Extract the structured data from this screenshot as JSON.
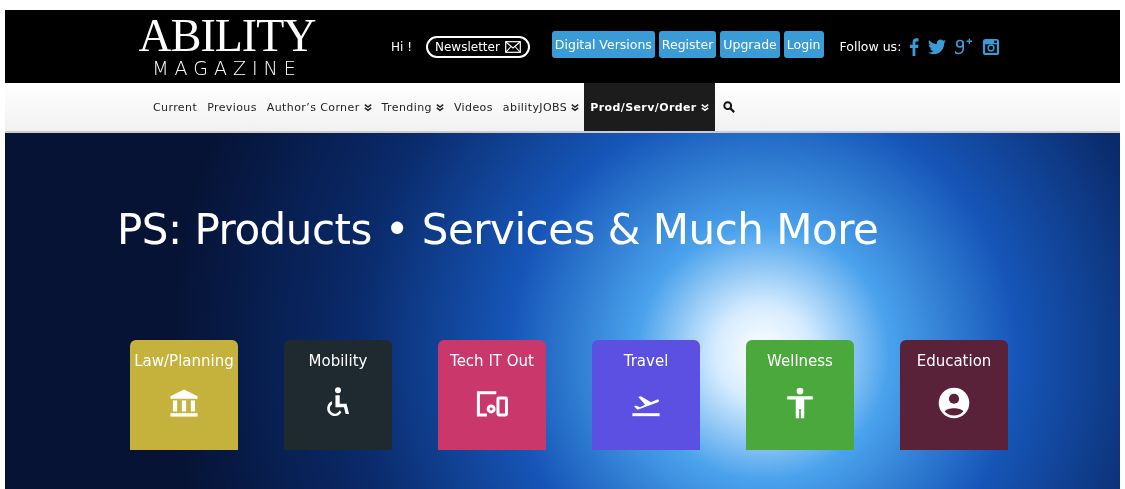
{
  "header": {
    "logo_title": "ABILITY",
    "logo_subtitle": "MAGAZINE",
    "greeting": "Hi !",
    "newsletter": "Newsletter",
    "buttons": [
      "Digital Versions",
      "Register",
      "Upgrade",
      "Login"
    ],
    "follow_label": "Follow us:",
    "social": [
      {
        "kind": "facebook"
      },
      {
        "kind": "twitter"
      },
      {
        "kind": "googleplus"
      },
      {
        "kind": "instagram"
      }
    ]
  },
  "nav": [
    {
      "label": "Current",
      "dropdown": false,
      "selected": false
    },
    {
      "label": "Previous",
      "dropdown": false,
      "selected": false
    },
    {
      "label": "Author’s Corner",
      "dropdown": true,
      "selected": false
    },
    {
      "label": "Trending",
      "dropdown": true,
      "selected": false
    },
    {
      "label": "Videos",
      "dropdown": false,
      "selected": false
    },
    {
      "label": "abilityJOBS",
      "dropdown": true,
      "selected": false
    },
    {
      "label": "Prod/Serv/Order",
      "dropdown": true,
      "selected": true
    }
  ],
  "hero": {
    "title": "PS: Products • Services & Much More",
    "categories": [
      {
        "label": "Law/Planning",
        "kind": "bank",
        "color": "#c4b23c"
      },
      {
        "label": "Mobility",
        "kind": "wheelchair",
        "color": "#1e2a30"
      },
      {
        "label": "Tech IT Out",
        "kind": "devices",
        "color": "#c9376b"
      },
      {
        "label": "Travel",
        "kind": "plane",
        "color": "#5b50e2"
      },
      {
        "label": "Wellness",
        "kind": "person",
        "color": "#4aa83c"
      },
      {
        "label": "Education",
        "kind": "account",
        "color": "#5a2238"
      }
    ]
  }
}
